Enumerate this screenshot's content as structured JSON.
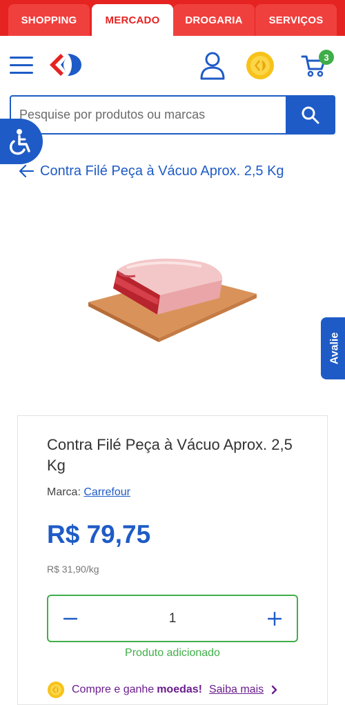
{
  "tabs": [
    {
      "label": "SHOPPING"
    },
    {
      "label": "MERCADO"
    },
    {
      "label": "DROGARIA"
    },
    {
      "label": "SERVIÇOS"
    }
  ],
  "header": {
    "cart_count": "3"
  },
  "search": {
    "placeholder": "Pesquise por produtos ou marcas"
  },
  "breadcrumb": {
    "back_label": "Contra Filé Peça à Vácuo Aprox. 2,5 Kg"
  },
  "side_tab": {
    "label": "Avalie"
  },
  "product": {
    "title": "Contra Filé Peça à Vácuo Aprox. 2,5 Kg",
    "brand_label": "Marca:",
    "brand_name": "Carrefour",
    "price": "R$ 79,75",
    "unit_price": "R$ 31,90/kg",
    "quantity": "1",
    "added_message": "Produto adicionado"
  },
  "promo": {
    "text": "Compre e ganhe",
    "highlight": "moedas!",
    "link": "Saiba mais"
  },
  "colors": {
    "brand_red": "#e52321",
    "brand_blue": "#1e5bc6",
    "success_green": "#3fae49",
    "promo_purple": "#6a1c8e"
  }
}
